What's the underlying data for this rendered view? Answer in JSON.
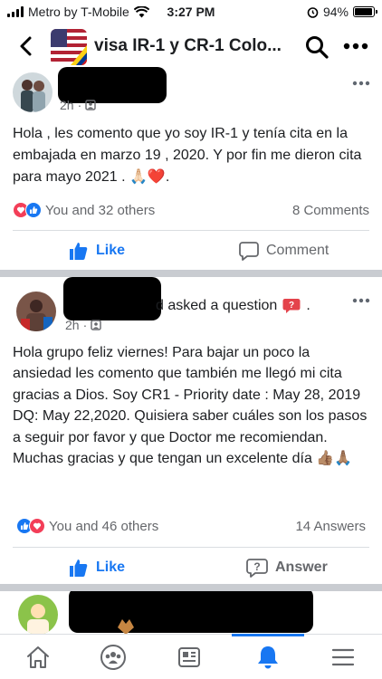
{
  "status_bar": {
    "carrier": "Metro by T-Mobile",
    "time": "3:27 PM",
    "battery": "94%",
    "battery_level": 0.94
  },
  "header": {
    "title": "visa IR-1 y CR-1 Colo..."
  },
  "posts": [
    {
      "time": "2h",
      "text": "Hola , les comento que yo soy IR-1 y tenía cita en la embajada en marzo 19 , 2020. Y por fin me dieron cita para mayo 2021 . 🙏🏻❤️.",
      "reactions": "You and 32 others",
      "comments": "8 Comments",
      "like_label": "Like",
      "comment_label": "Comment"
    },
    {
      "header_suffix": "d asked a question",
      "time": "2h",
      "text": "Hola grupo feliz viernes! Para bajar un poco la ansiedad les comento que también me llegó mi cita gracias a Dios. Soy CR1 - Priority date : May 28, 2019 DQ: May 22,2020. Quisiera saber cuáles son los pasos a seguir por favor y que Doctor me recomiendan. Muchas gracias y que tengan un excelente día 👍🏽🙏🏽",
      "reactions": "You and 46 others",
      "comments": "14 Answers",
      "like_label": "Like",
      "answer_label": "Answer"
    }
  ],
  "icons": {
    "like": "thumbs-up-icon",
    "comment": "comment-bubble-icon",
    "answer": "question-bubble-icon",
    "nav": [
      "home-icon",
      "groups-icon",
      "news-icon",
      "bell-icon",
      "menu-icon"
    ]
  },
  "colors": {
    "brand": "#1877f2",
    "love": "#f33e58",
    "question": "#e4434b"
  }
}
